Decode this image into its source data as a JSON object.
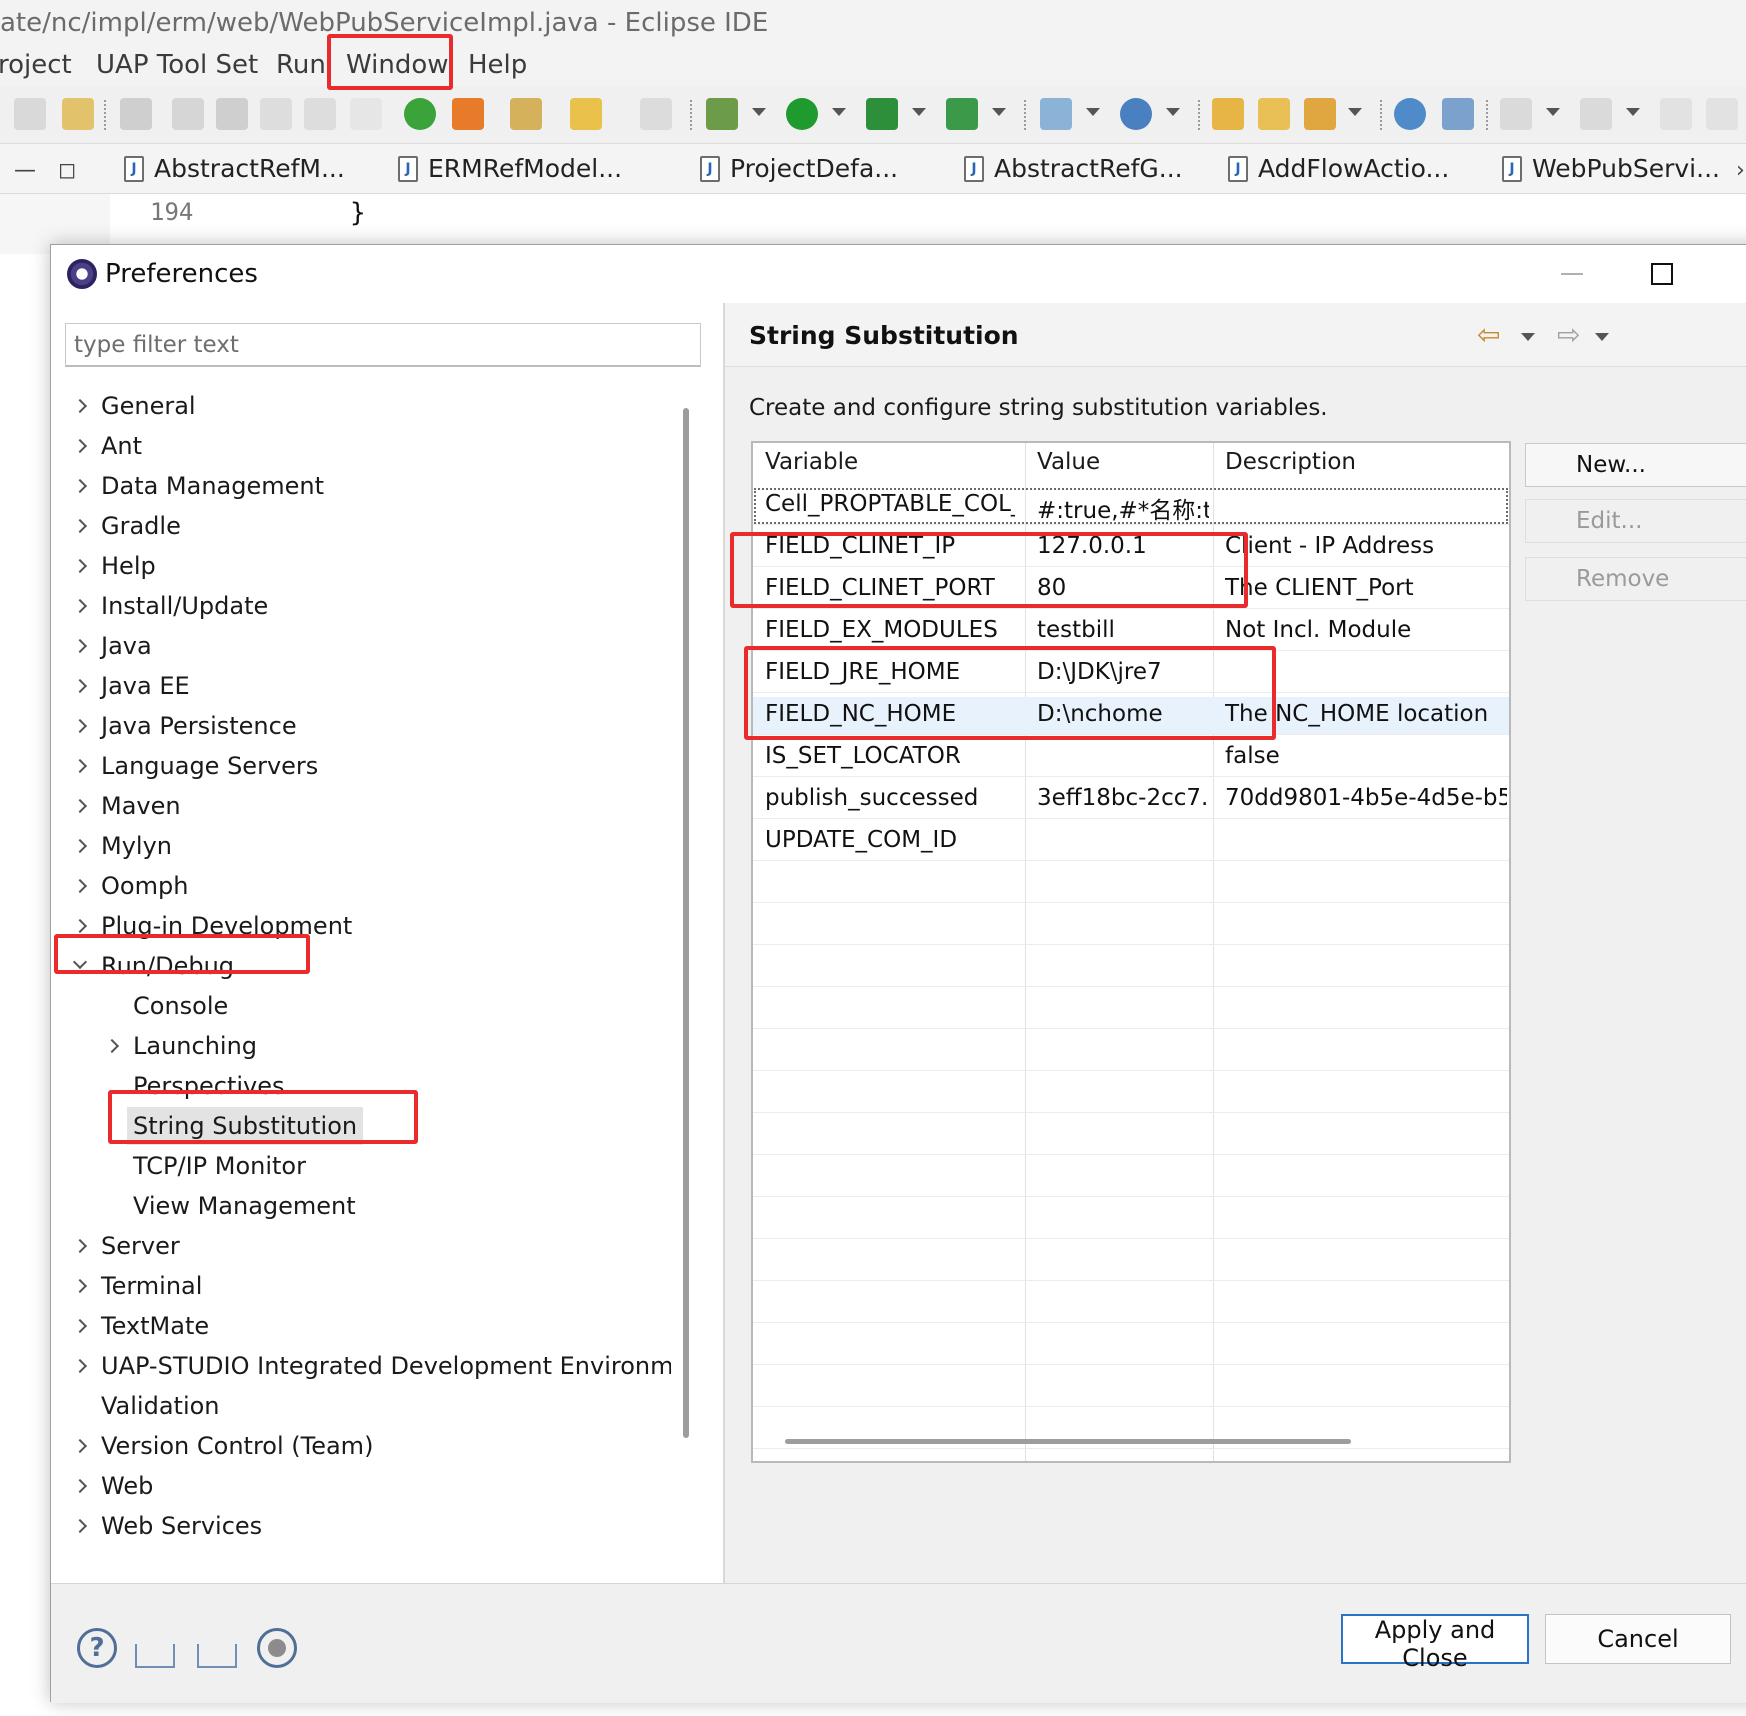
{
  "window": {
    "title": "ate/nc/impl/erm/web/WebPubServiceImpl.java - Eclipse IDE"
  },
  "menubar": {
    "items": [
      "roject",
      "UAP Tool Set",
      "Run",
      "Window",
      "Help"
    ]
  },
  "editor": {
    "tabs": [
      "AbstractRefM...",
      "ERMRefModel...",
      "ProjectDefa...",
      "AbstractRefG...",
      "AddFlowActio...",
      "WebPubServi..."
    ],
    "overflow_glyph": "›",
    "line_number": "194",
    "line_code": "}"
  },
  "dialog": {
    "title": "Preferences",
    "filter_placeholder": "type filter text",
    "tree": [
      {
        "label": "General",
        "expandable": true,
        "level": 0
      },
      {
        "label": "Ant",
        "expandable": true,
        "level": 0
      },
      {
        "label": "Data Management",
        "expandable": true,
        "level": 0
      },
      {
        "label": "Gradle",
        "expandable": true,
        "level": 0
      },
      {
        "label": "Help",
        "expandable": true,
        "level": 0
      },
      {
        "label": "Install/Update",
        "expandable": true,
        "level": 0
      },
      {
        "label": "Java",
        "expandable": true,
        "level": 0
      },
      {
        "label": "Java EE",
        "expandable": true,
        "level": 0
      },
      {
        "label": "Java Persistence",
        "expandable": true,
        "level": 0
      },
      {
        "label": "Language Servers",
        "expandable": true,
        "level": 0
      },
      {
        "label": "Maven",
        "expandable": true,
        "level": 0
      },
      {
        "label": "Mylyn",
        "expandable": true,
        "level": 0
      },
      {
        "label": "Oomph",
        "expandable": true,
        "level": 0
      },
      {
        "label": "Plug-in Development",
        "expandable": true,
        "level": 0
      },
      {
        "label": "Run/Debug",
        "expandable": true,
        "expanded": true,
        "level": 0
      },
      {
        "label": "Console",
        "expandable": false,
        "level": 1
      },
      {
        "label": "Launching",
        "expandable": true,
        "level": 1
      },
      {
        "label": "Perspectives",
        "expandable": false,
        "level": 1
      },
      {
        "label": "String Substitution",
        "expandable": false,
        "level": 1,
        "selected": true
      },
      {
        "label": "TCP/IP Monitor",
        "expandable": false,
        "level": 1
      },
      {
        "label": "View Management",
        "expandable": false,
        "level": 1
      },
      {
        "label": "Server",
        "expandable": true,
        "level": 0
      },
      {
        "label": "Terminal",
        "expandable": true,
        "level": 0
      },
      {
        "label": "TextMate",
        "expandable": true,
        "level": 0
      },
      {
        "label": "UAP-STUDIO Integrated Development Environme",
        "expandable": true,
        "level": 0
      },
      {
        "label": "Validation",
        "expandable": false,
        "level": 0
      },
      {
        "label": "Version Control (Team)",
        "expandable": true,
        "level": 0
      },
      {
        "label": "Web",
        "expandable": true,
        "level": 0
      },
      {
        "label": "Web Services",
        "expandable": true,
        "level": 0
      }
    ],
    "page": {
      "title": "String Substitution",
      "description": "Create and configure string substitution variables.",
      "columns": [
        "Variable",
        "Value",
        "Description"
      ],
      "rows": [
        {
          "variable": "Cell_PROPTABLE_COL_...",
          "value": "#:true,#*名称:t...",
          "description": ""
        },
        {
          "variable": "FIELD_CLINET_IP",
          "value": "127.0.0.1",
          "description": "Client - IP Address"
        },
        {
          "variable": "FIELD_CLINET_PORT",
          "value": "80",
          "description": "The CLIENT_Port"
        },
        {
          "variable": "FIELD_EX_MODULES",
          "value": "testbill",
          "description": "Not Incl. Module"
        },
        {
          "variable": "FIELD_JRE_HOME",
          "value": "D:\\JDK\\jre7",
          "description": ""
        },
        {
          "variable": "FIELD_NC_HOME",
          "value": "D:\\nchome",
          "description": "The NC_HOME location"
        },
        {
          "variable": "IS_SET_LOCATOR",
          "value": "",
          "description": "false"
        },
        {
          "variable": "publish_successed",
          "value": "3eff18bc-2cc7...",
          "description": "70dd9801-4b5e-4d5e-b5..."
        },
        {
          "variable": "UPDATE_COM_ID",
          "value": "",
          "description": ""
        }
      ],
      "buttons": {
        "new": "New...",
        "edit": "Edit...",
        "remove": "Remove"
      }
    },
    "footer": {
      "apply_close": "Apply and Close",
      "cancel": "Cancel",
      "help_glyph": "?"
    }
  },
  "colors": {
    "annotation_red": "#ea2b2b",
    "selection_blue": "#e8f2fc",
    "default_button_border": "#2a74c8"
  }
}
